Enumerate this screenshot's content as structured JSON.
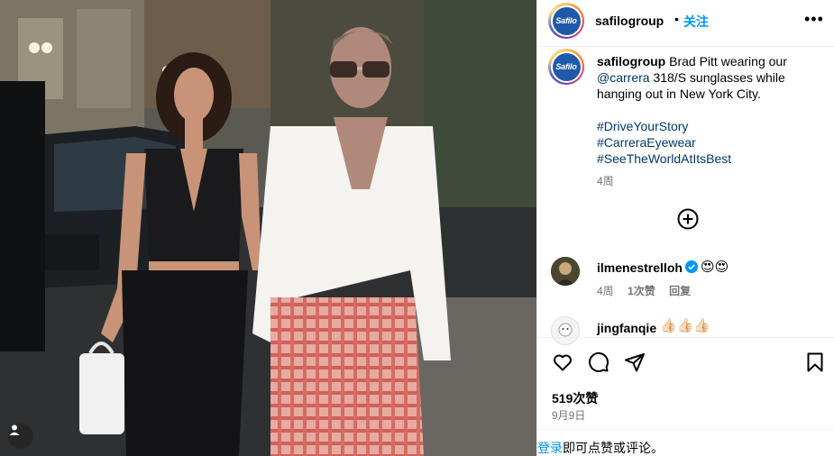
{
  "post": {
    "username": "safilogroup",
    "avatar_logo_text": "Safilo",
    "separator": "•",
    "follow_label": "关注",
    "more_label": "•••"
  },
  "caption": {
    "username": "safilogroup",
    "text_before_mention": "Brad Pitt wearing our",
    "mention": "@carrera",
    "text_after_mention": "318/S sunglasses while hanging out in New York City.",
    "hashtags": [
      "#DriveYourStory",
      "#CarreraEyewear",
      "#SeeTheWorldAtItsBest"
    ],
    "time": "4周"
  },
  "comments": [
    {
      "username": "ilmenestrelloh",
      "verified": true,
      "text": "😍😍",
      "time": "4周",
      "likes": "1次赞",
      "reply": "回复"
    },
    {
      "username": "jingfanqie",
      "text": "👍🏻👍🏻👍🏻"
    }
  ],
  "actions": {
    "like_icon": "heart-icon",
    "comment_icon": "comment-icon",
    "share_icon": "share-icon",
    "save_icon": "bookmark-icon"
  },
  "stats": {
    "likes": "519次赞",
    "date": "9月9日"
  },
  "footer": {
    "login_label": "登录",
    "login_suffix": "即可点赞或评论。"
  },
  "colors": {
    "accent": "#0095f6",
    "link": "#00376b",
    "muted": "#737373",
    "verified": "#0095f6"
  }
}
